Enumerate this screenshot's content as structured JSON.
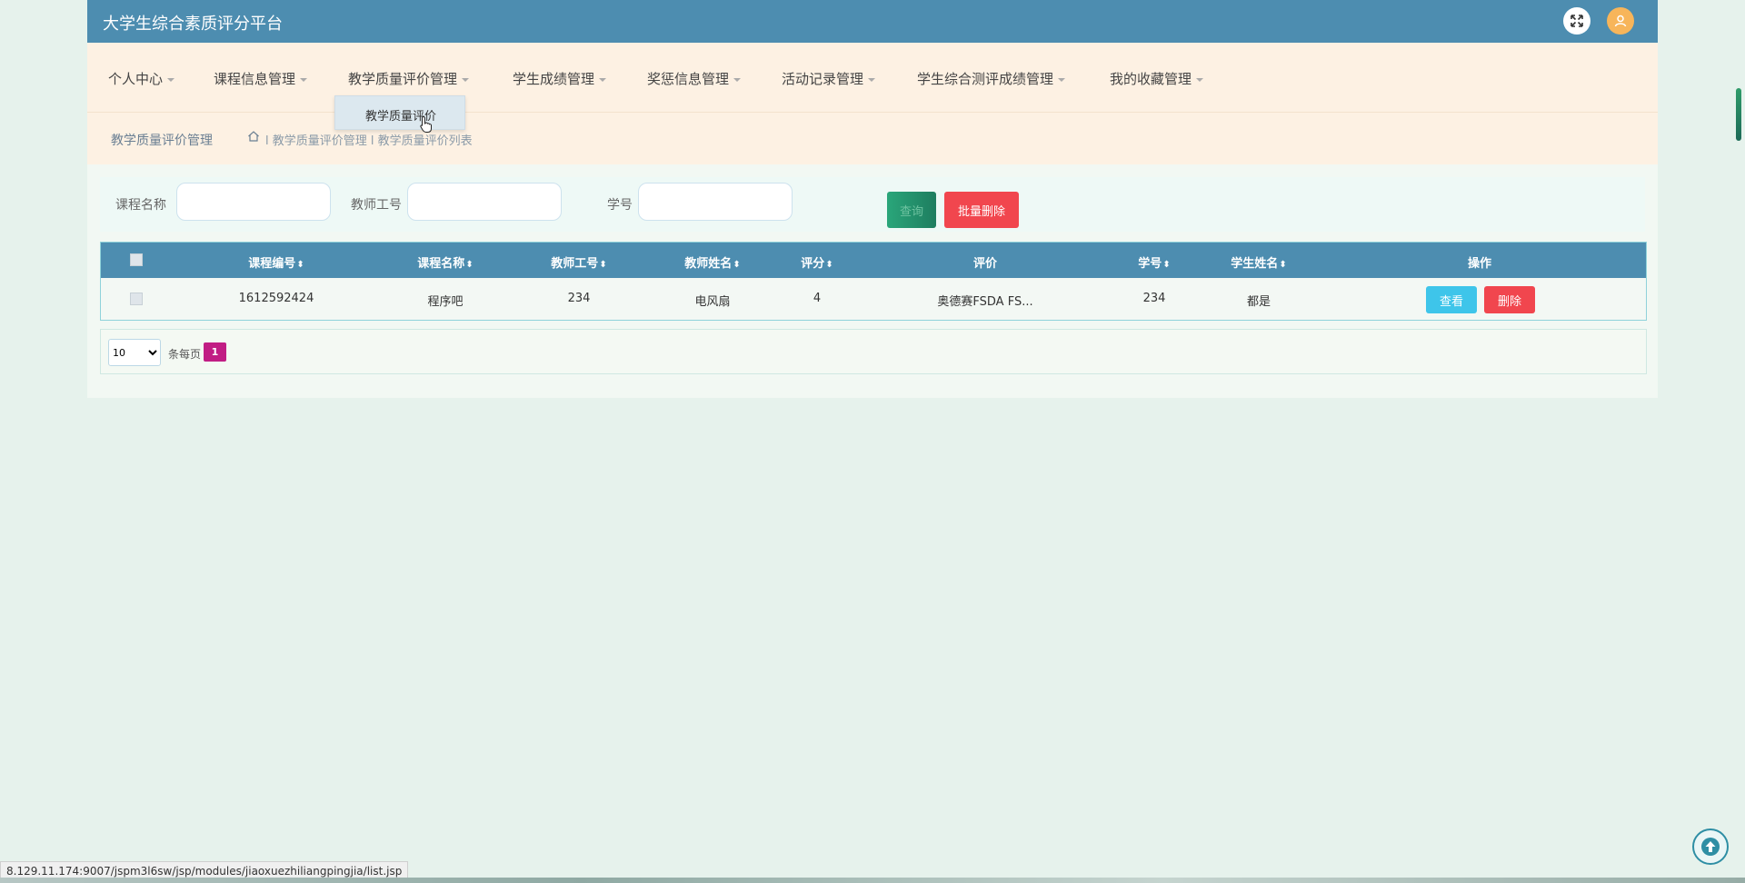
{
  "header": {
    "site_title": "大学生综合素质评分平台",
    "fullscreen_icon": "fullscreen-icon",
    "user_icon": "user-avatar-icon",
    "colors": {
      "topbar": "#4d8db0",
      "avatar": "#f7b55a"
    }
  },
  "nav": {
    "items": [
      {
        "label": "个人中心"
      },
      {
        "label": "课程信息管理"
      },
      {
        "label": "教学质量评价管理"
      },
      {
        "label": "学生成绩管理"
      },
      {
        "label": "奖惩信息管理"
      },
      {
        "label": "活动记录管理"
      },
      {
        "label": "学生综合测评成绩管理"
      },
      {
        "label": "我的收藏管理"
      }
    ],
    "dropdown": {
      "item": "教学质量评价"
    }
  },
  "breadcrumb": {
    "title": "教学质量评价管理",
    "path": "l 教学质量评价管理 l 教学质量评价列表"
  },
  "search": {
    "course_name_label": "课程名称",
    "teacher_id_label": "教师工号",
    "student_id_label": "学号",
    "course_name_value": "",
    "teacher_id_value": "",
    "student_id_value": "",
    "search_button": "查询",
    "batch_delete_button": "批量删除"
  },
  "table": {
    "headers": {
      "course_code": "课程编号",
      "course_name": "课程名称",
      "teacher_id": "教师工号",
      "teacher_name": "教师姓名",
      "score": "评分",
      "comment": "评价",
      "student_id": "学号",
      "student_name": "学生姓名",
      "actions": "操作"
    },
    "sort_glyph": "⬍",
    "rows": [
      {
        "course_code": "1612592424",
        "course_name": "程序吧",
        "teacher_id": "234",
        "teacher_name": "电风扇",
        "score": "4",
        "comment": "奥德赛FSDA FS...",
        "student_id": "234",
        "student_name": "都是",
        "view_button": "查看",
        "delete_button": "删除"
      }
    ]
  },
  "pager": {
    "page_size": "10",
    "per_page_label": "条每页",
    "current_page": "1"
  },
  "status_bar": {
    "url": "8.129.11.174:9007/jspm3l6sw/jsp/modules/jiaoxuezhiliangpingjia/list.jsp"
  }
}
